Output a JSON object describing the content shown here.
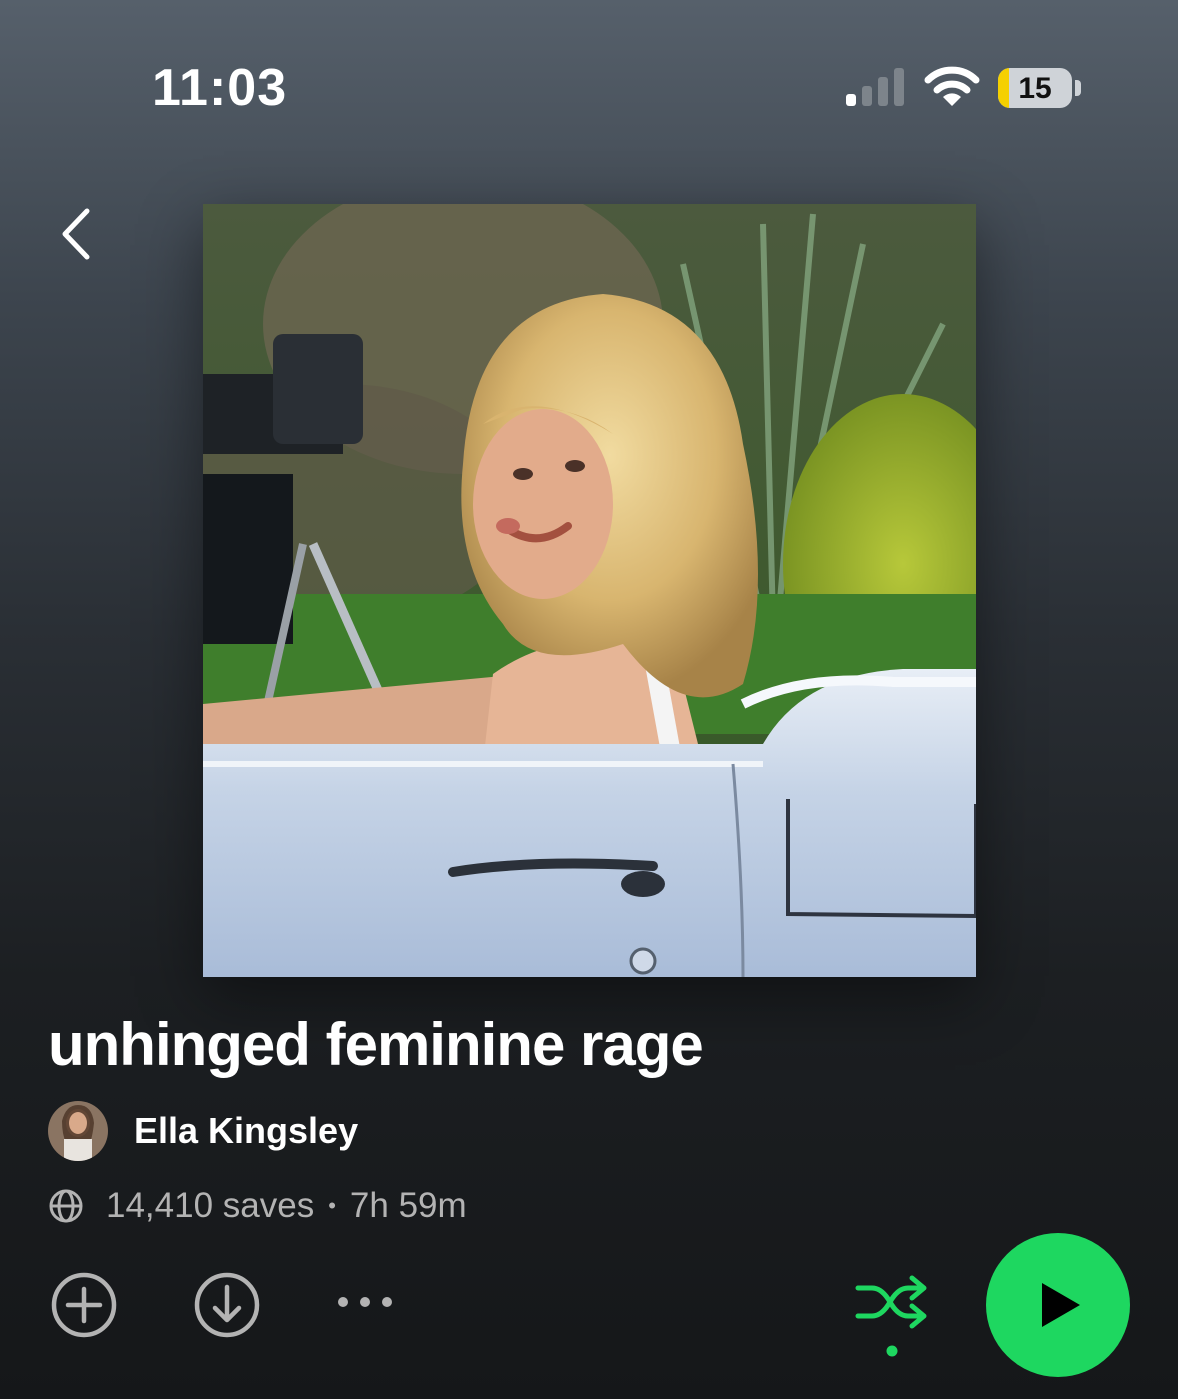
{
  "status_bar": {
    "time": "11:03",
    "battery_level": "15",
    "battery_fraction": 0.15,
    "signal_bars_active": 1,
    "signal_bars_total": 4
  },
  "navigation": {
    "back_icon": "chevron-left-icon"
  },
  "playlist": {
    "title": "unhinged feminine rage",
    "owner": "Ella Kingsley",
    "saves": "14,410 saves",
    "separator": "•",
    "duration": "7h 59m"
  },
  "actions": {
    "add_icon": "plus-circle-icon",
    "download_icon": "download-circle-icon",
    "more_icon": "more-horizontal-icon",
    "shuffle_icon": "shuffle-icon",
    "play_icon": "play-icon"
  },
  "colors": {
    "accent": "#1ed760",
    "text_primary": "#ffffff",
    "text_secondary": "#b3b3b3",
    "battery_low": "#f5d000"
  }
}
